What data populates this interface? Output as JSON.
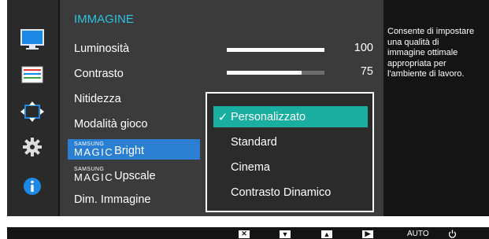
{
  "menu": {
    "title": "IMMAGINE",
    "items": [
      {
        "label": "Luminosità",
        "value": "100",
        "level": 1.0
      },
      {
        "label": "Contrasto",
        "value": "75",
        "level": 0.77
      },
      {
        "label": "Nitidezza"
      },
      {
        "label": "Modalità gioco"
      },
      {
        "brand_top": "SAMSUNG",
        "brand_main": "MAGIC",
        "suffix": "Bright",
        "selected": true
      },
      {
        "brand_top": "SAMSUNG",
        "brand_main": "MAGIC",
        "suffix": "Upscale"
      },
      {
        "label": "Dim. Immagine"
      }
    ]
  },
  "dropdown": {
    "options": [
      "Personalizzato",
      "Standard",
      "Cinema",
      "Contrasto Dinamico"
    ],
    "selected": "Personalizzato"
  },
  "help": {
    "lines": [
      "Consente di impostare",
      "una qualità di",
      "immagine ottimale",
      "appropriata per",
      "l'ambiente di lavoro."
    ]
  },
  "categories": [
    "monitor-icon",
    "settings-panel-icon",
    "resize-arrows-icon",
    "gear-icon",
    "info-icon"
  ],
  "bottom_bar": {
    "auto_label": "AUTO",
    "keys": [
      "close-icon",
      "down-arrow-icon",
      "up-arrow-icon",
      "right-arrow-icon",
      "power-icon"
    ]
  },
  "colors": {
    "accent_title": "#2ec3e0",
    "selected_row": "#2b7fd2",
    "dropdown_active": "#1aaea0",
    "info_blue": "#1e88e5"
  }
}
